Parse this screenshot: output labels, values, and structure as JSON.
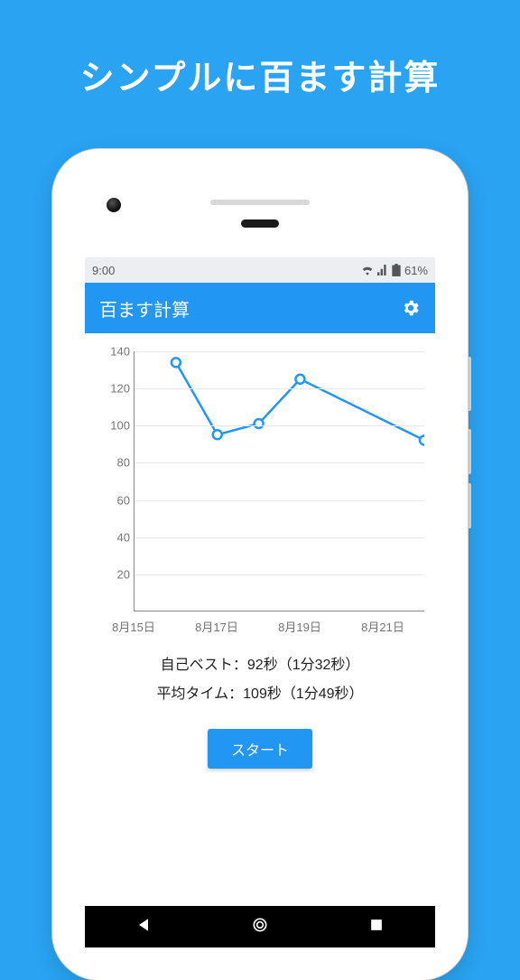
{
  "headline": "シンプルに百ます計算",
  "statusbar": {
    "time": "9:00",
    "battery": "61%"
  },
  "appbar": {
    "title": "百ます計算"
  },
  "chart_data": {
    "type": "line",
    "x": [
      "8月15日",
      "8月16日",
      "8月17日",
      "8月18日",
      "8月19日",
      "8月20日",
      "8月21日",
      "8月22日"
    ],
    "x_ticks": [
      "8月15日",
      "8月17日",
      "8月19日",
      "8月21日"
    ],
    "values": [
      null,
      134,
      95,
      101,
      125,
      null,
      null,
      92
    ],
    "ylim": [
      0,
      140
    ],
    "y_ticks": [
      20,
      40,
      60,
      80,
      100,
      120,
      140
    ],
    "title": "",
    "xlabel": "",
    "ylabel": ""
  },
  "stats": {
    "best_label": "自己ベスト：",
    "best_value": "92秒（1分32秒）",
    "avg_label": "平均タイム：",
    "avg_value": "109秒（1分49秒）"
  },
  "buttons": {
    "start": "スタート"
  }
}
